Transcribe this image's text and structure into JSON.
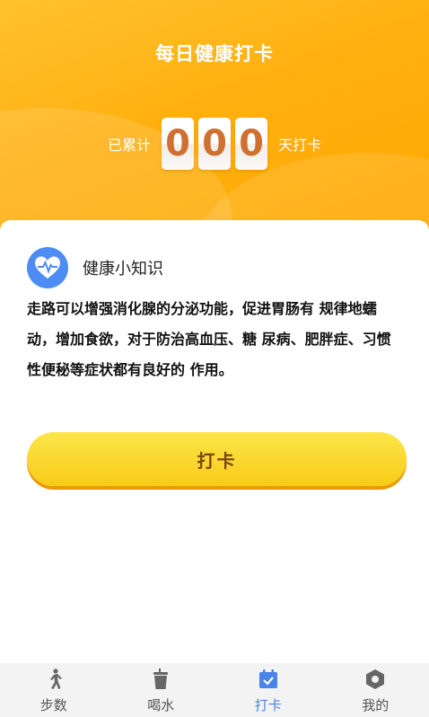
{
  "header": {
    "title": "每日健康打卡",
    "counter_prefix": "已累计",
    "counter_digits": [
      "0",
      "0",
      "0"
    ],
    "counter_suffix": "天打卡"
  },
  "tip": {
    "title": "健康小知识",
    "icon": "heart-pulse-icon",
    "body": "走路可以增强消化腺的分泌功能，促进胃肠有 规律地蠕动，增加食欲，对于防治高血压、糖 尿病、肥胖症、习惯性便秘等症状都有良好的 作用。"
  },
  "checkin_button": {
    "label": "打卡"
  },
  "tabbar": {
    "items": [
      {
        "label": "步数",
        "icon": "walking-icon",
        "active": false
      },
      {
        "label": "喝水",
        "icon": "cup-icon",
        "active": false
      },
      {
        "label": "打卡",
        "icon": "calendar-check-icon",
        "active": true
      },
      {
        "label": "我的",
        "icon": "user-hexagon-icon",
        "active": false
      }
    ]
  },
  "colors": {
    "header_orange": "#ffb010",
    "digit_text": "#d07030",
    "tip_icon_blue": "#4d8cf5",
    "button_yellow": "#f8cc18",
    "button_text": "#7a4710",
    "tab_active": "#4a84e8",
    "tab_inactive": "#555555"
  }
}
